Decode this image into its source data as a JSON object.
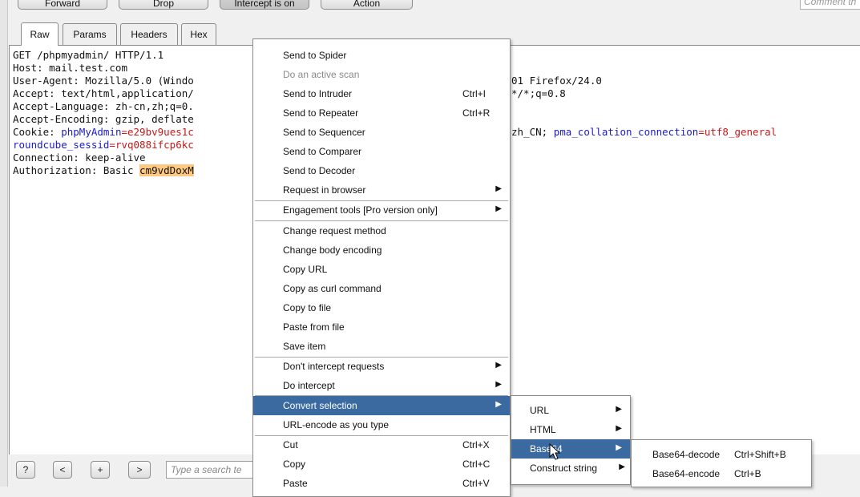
{
  "toolbar": {
    "forward": "Forward",
    "drop": "Drop",
    "intercept": "Intercept is on",
    "action": "Action",
    "comment_placeholder": "Comment th"
  },
  "tabs": [
    "Raw",
    "Params",
    "Headers",
    "Hex"
  ],
  "request": {
    "line1": "GET /phpmyadmin/ HTTP/1.1",
    "line2": "Host: mail.test.com",
    "line3a": "User-Agent: Mozilla/5.0 (Windo",
    "line3b": "01 Firefox/24.0",
    "line4a": "Accept: text/html,application/",
    "line4b": "*/*;q=0.8",
    "line5": "Accept-Language: zh-cn,zh;q=0.",
    "line6": "Accept-Encoding: gzip, deflate",
    "cookie_label": "Cookie: ",
    "cookie_k1": "phpMyAdmin",
    "cookie_v1": "=e29bv9ues1c",
    "cookie_b1": "zh_CN; ",
    "cookie_k2": "pma_collation_connection",
    "cookie_v2": "=utf8_general",
    "cookie2_k": "roundcube_sessid",
    "cookie2_v": "=rvq088ifcp6kc",
    "line9": "Connection: keep-alive",
    "auth_label": "Authorization: Basic ",
    "auth_value": "cm9vdDoxM"
  },
  "context_menu": {
    "items": [
      {
        "label": "Send to Spider"
      },
      {
        "label": "Do an active scan"
      },
      {
        "label": "Send to Intruder",
        "shortcut": "Ctrl+I"
      },
      {
        "label": "Send to Repeater",
        "shortcut": "Ctrl+R"
      },
      {
        "label": "Send to Sequencer"
      },
      {
        "label": "Send to Comparer"
      },
      {
        "label": "Send to Decoder"
      },
      {
        "label": "Request in browser"
      },
      {
        "label": "Engagement tools [Pro version only]"
      },
      {
        "label": "Change request method"
      },
      {
        "label": "Change body encoding"
      },
      {
        "label": "Copy URL"
      },
      {
        "label": "Copy as curl command"
      },
      {
        "label": "Copy to file"
      },
      {
        "label": "Paste from file"
      },
      {
        "label": "Save item"
      },
      {
        "label": "Don't intercept requests"
      },
      {
        "label": "Do intercept"
      },
      {
        "label": "Convert selection"
      },
      {
        "label": "URL-encode as you type"
      },
      {
        "label": "Cut",
        "shortcut": "Ctrl+X"
      },
      {
        "label": "Copy",
        "shortcut": "Ctrl+C"
      },
      {
        "label": "Paste",
        "shortcut": "Ctrl+V"
      }
    ]
  },
  "convert_submenu": {
    "items": [
      {
        "label": "URL"
      },
      {
        "label": "HTML"
      },
      {
        "label": "Base64"
      },
      {
        "label": "Construct string"
      }
    ]
  },
  "base64_submenu": {
    "items": [
      {
        "label": "Base64-decode",
        "shortcut": "Ctrl+Shift+B"
      },
      {
        "label": "Base64-encode",
        "shortcut": "Ctrl+B"
      }
    ]
  },
  "search": {
    "help": "?",
    "prev": "<",
    "add": "+",
    "next": ">",
    "placeholder": "Type a search te"
  },
  "colors": {
    "menu_highlight": "#3a6aa0",
    "cookie_key": "#1a1ad0",
    "cookie_value": "#c81818",
    "selection": "#ffc880"
  }
}
